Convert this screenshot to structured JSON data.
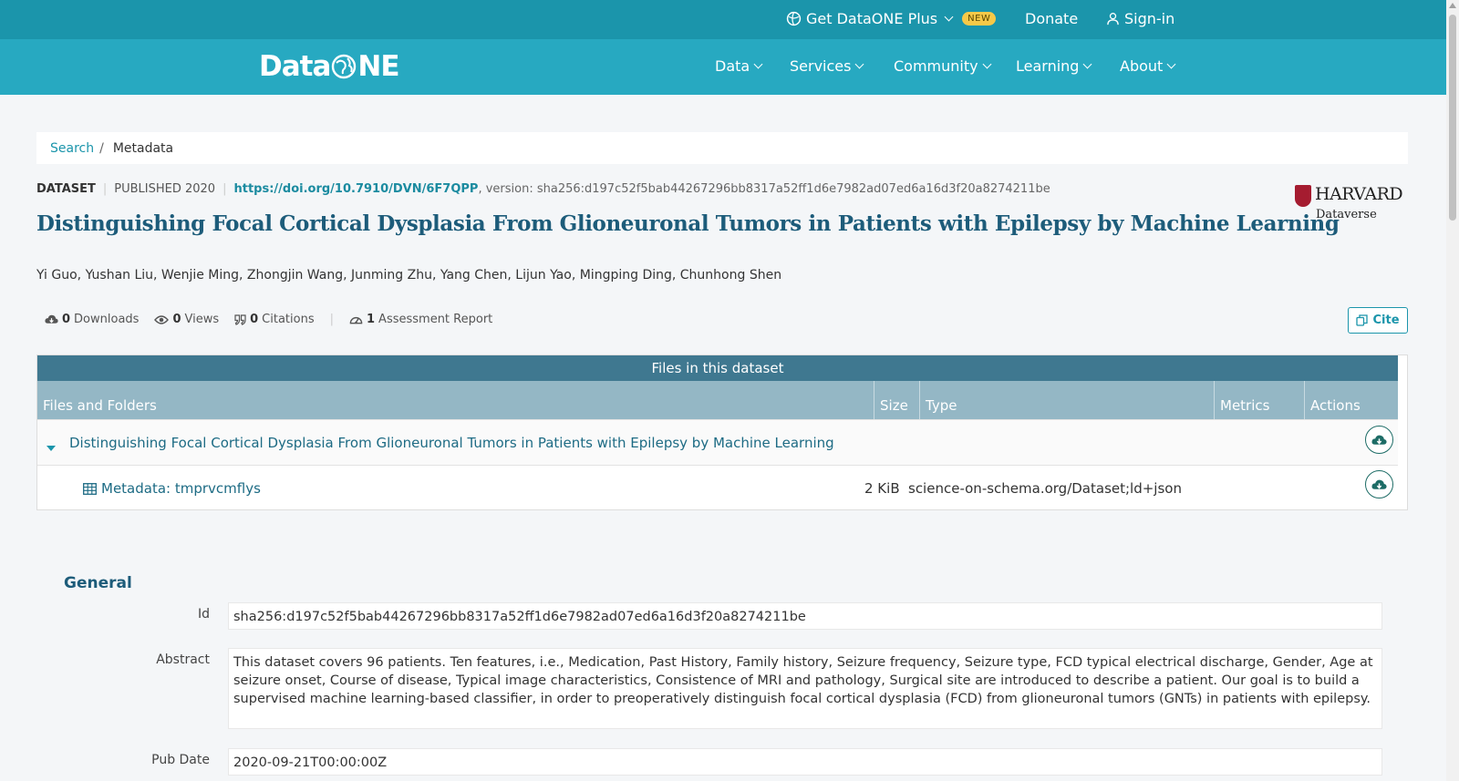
{
  "topbar": {
    "plus_label": "Get DataONE Plus",
    "new_badge": "NEW",
    "donate_label": "Donate",
    "signin_label": "Sign-in"
  },
  "nav": {
    "logo_left": "Data",
    "logo_right": "NE",
    "items": [
      {
        "label": "Data"
      },
      {
        "label": "Services"
      },
      {
        "label": "Community"
      },
      {
        "label": "Learning"
      },
      {
        "label": "About"
      }
    ]
  },
  "breadcrumb": {
    "search": "Search",
    "separator": "/",
    "current": "Metadata"
  },
  "dataset": {
    "type": "DATASET",
    "published": "PUBLISHED 2020",
    "doi": "https://doi.org/10.7910/DVN/6F7QPP",
    "version": ", version: sha256:d197c52f5bab44267296bb8317a52ff1d6e7982ad07ed6a16d3f20a8274211be",
    "title": "Distinguishing Focal Cortical Dysplasia From Glioneuronal Tumors in Patients with Epilepsy by Machine Learning",
    "authors": "Yi Guo, Yushan Liu, Wenjie Ming, Zhongjin Wang, Junming Zhu, Yang Chen, Lijun Yao, Mingping Ding, Chunhong Shen",
    "repository": {
      "name": "HARVARD",
      "sub": "Dataverse"
    }
  },
  "stats": {
    "downloads_count": "0",
    "downloads_label": "Downloads",
    "views_count": "0",
    "views_label": "Views",
    "citations_count": "0",
    "citations_label": "Citations",
    "assessment_count": "1",
    "assessment_label": "Assessment Report",
    "cite_label": "Cite"
  },
  "files": {
    "caption": "Files in this dataset",
    "columns": [
      "Files and Folders",
      "Size",
      "Type",
      "Metrics",
      "Actions"
    ],
    "folder": {
      "name": "Distinguishing Focal Cortical Dysplasia From Glioneuronal Tumors in Patients with Epilepsy by Machine Learning"
    },
    "file": {
      "name": "Metadata: tmprvcmflys",
      "size": "2 KiB",
      "type": "science-on-schema.org/Dataset;ld+json"
    }
  },
  "general": {
    "heading": "General",
    "fields": [
      {
        "label": "Id",
        "value": "sha256:d197c52f5bab44267296bb8317a52ff1d6e7982ad07ed6a16d3f20a8274211be"
      },
      {
        "label": "Abstract",
        "value": "This dataset covers 96 patients. Ten features, i.e., Medication, Past History, Family history, Seizure frequency, Seizure type, FCD typical electrical discharge, Gender, Age at seizure onset, Course of disease, Typical image characteristics, Consistence of MRI and pathology, Surgical site are introduced to describe a patient. Our goal is to build a supervised machine learning-based classifier, in order to preoperatively distinguish focal cortical dysplasia (FCD) from glioneuronal tumors (GNTs) in patients with epilepsy."
      },
      {
        "label": "Pub Date",
        "value": "2020-09-21T00:00:00Z"
      }
    ]
  },
  "colors": {
    "topbar": "#1b95ab",
    "navbar": "#27a9c1",
    "title": "#1d5c7a",
    "table_caption": "#3f7890",
    "table_header": "#94b7c5"
  }
}
